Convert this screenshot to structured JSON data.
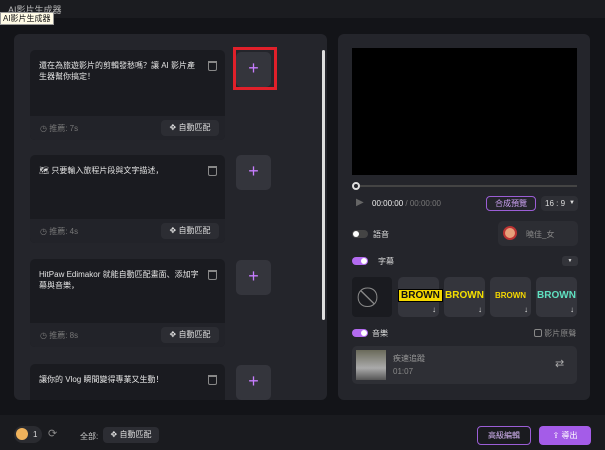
{
  "window": {
    "title": "AI影片生成器",
    "tooltip": "AI影片生成器"
  },
  "scenes": [
    {
      "text": "還在為旅遊影片的剪輯發愁嗎？讓 AI 影片產生器幫你搞定！",
      "duration": "推薦: 7s",
      "auto": "自動匹配"
    },
    {
      "text": "🗺 只要輸入旅程片段與文字描述，",
      "duration": "推薦: 4s",
      "auto": "自動匹配"
    },
    {
      "text": "HitPaw Edimakor 就能自動匹配畫面、添加字幕與音樂，",
      "duration": "推薦: 8s",
      "auto": "自動匹配"
    },
    {
      "text": "讓你的 Vlog 瞬間變得專業又生動！"
    }
  ],
  "add_label": "+",
  "player": {
    "current": "00:00:00",
    "total": "/ 00:00:00",
    "preview": "合成預覽",
    "ratio": "16 : 9"
  },
  "voice": {
    "label": "語音",
    "on": false,
    "voice_name": "曉佳_女"
  },
  "subtitle": {
    "label": "字幕",
    "on": true,
    "styles": [
      "BROWN",
      "BROWN",
      "BROWN",
      "BROWN"
    ]
  },
  "music": {
    "label": "音樂",
    "on": true,
    "original_label": "影片原聲",
    "track": "疾速追蹤",
    "length": "01:07"
  },
  "bottom": {
    "credits": "1",
    "all_label": "全部:",
    "auto": "自動匹配",
    "advanced": "高級編輯",
    "export": "導出"
  },
  "colors": {
    "accent": "#b36bf0",
    "highlight": "#e0202a"
  }
}
